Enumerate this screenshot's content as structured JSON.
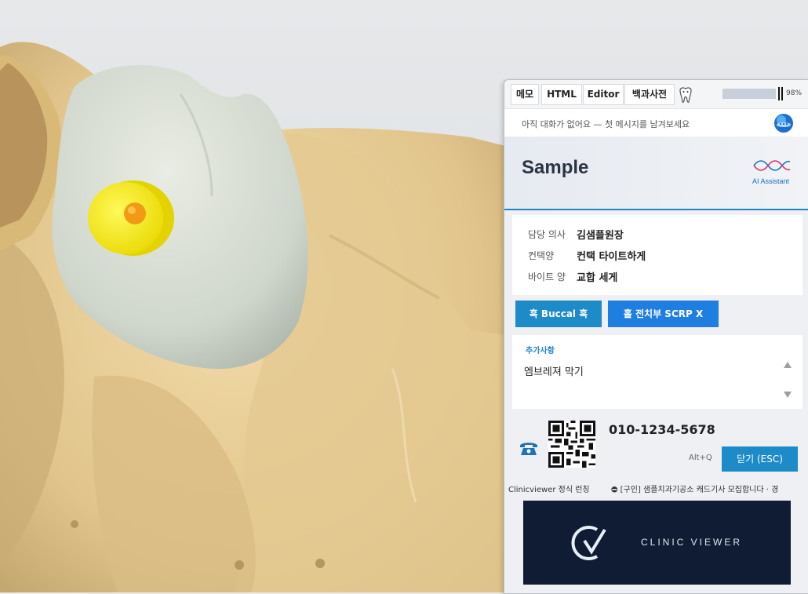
{
  "tabs": [
    {
      "label": "메모"
    },
    {
      "label": "HTML"
    },
    {
      "label": "Editor"
    },
    {
      "label": "백과사전"
    }
  ],
  "progress": {
    "value": 0.98,
    "text": "98%"
  },
  "chat": {
    "hint": "아직 대화가 없어요 — 첫 메시지를 남겨보세요"
  },
  "header": {
    "title": "Sample",
    "ai_label": "AI Assistant"
  },
  "info": [
    {
      "label": "담당 의사",
      "value": "김샘플원장"
    },
    {
      "label": "컨택양",
      "value": "컨택 타이트하게"
    },
    {
      "label": "바이트 양",
      "value": "교합 세게"
    }
  ],
  "chips": [
    {
      "label": "흑  Buccal 흑",
      "color": "#1e8bc9"
    },
    {
      "label": "홀  전치부 SCRP X",
      "color": "#1f7fe0"
    }
  ],
  "extra": {
    "title": "추가사항",
    "text": "엠브레져 막기"
  },
  "contact": {
    "phone": "010-1234-5678",
    "shortcut": "Alt+Q",
    "close_label": "닫기 (ESC)"
  },
  "footer": {
    "left": "Clinicviewer 정식 런칭",
    "right": "[구인] 샘플치과기공소 캐드기사 모집합니다 · 경"
  },
  "banner": {
    "text": "CLINIC VIEWER"
  },
  "colors": {
    "accent": "#1e8bc9",
    "header_line": "#1e86c8",
    "marker": "#ffec00"
  },
  "icons": [
    "tooth-icon",
    "assistant-orb-icon",
    "dna-icon",
    "phone-icon",
    "qr-code",
    "clinicviewer-logo"
  ]
}
